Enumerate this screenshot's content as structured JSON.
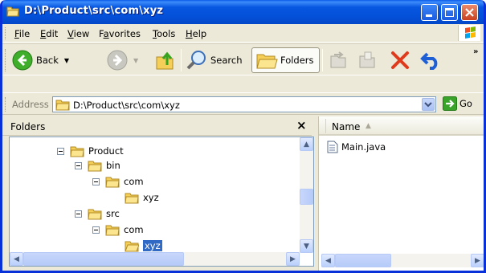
{
  "window": {
    "title": "D:\\Product\\src\\com\\xyz"
  },
  "menu": [
    "File",
    "Edit",
    "View",
    "Favorites",
    "Tools",
    "Help"
  ],
  "menu_underline": [
    "F",
    "E",
    "V",
    "a",
    "T",
    "H"
  ],
  "toolbar": {
    "back": "Back",
    "search": "Search",
    "folders": "Folders"
  },
  "address": {
    "label": "Address",
    "value": "D:\\Product\\src\\com\\xyz",
    "go": "Go"
  },
  "folders_panel": {
    "title": "Folders",
    "close": "×"
  },
  "tree": [
    {
      "label": "Product",
      "expanded": true
    },
    {
      "label": "bin",
      "expanded": true
    },
    {
      "label": "com",
      "expanded": true
    },
    {
      "label": "xyz",
      "expanded": null
    },
    {
      "label": "src",
      "expanded": true
    },
    {
      "label": "com",
      "expanded": true
    },
    {
      "label": "xyz",
      "expanded": null,
      "selected": true
    }
  ],
  "files": {
    "column_name": "Name",
    "items": [
      {
        "name": "Main.java"
      }
    ]
  },
  "colors": {
    "titlebar": "#0450d8",
    "selection": "#316ac5",
    "chrome": "#ece9d8"
  }
}
